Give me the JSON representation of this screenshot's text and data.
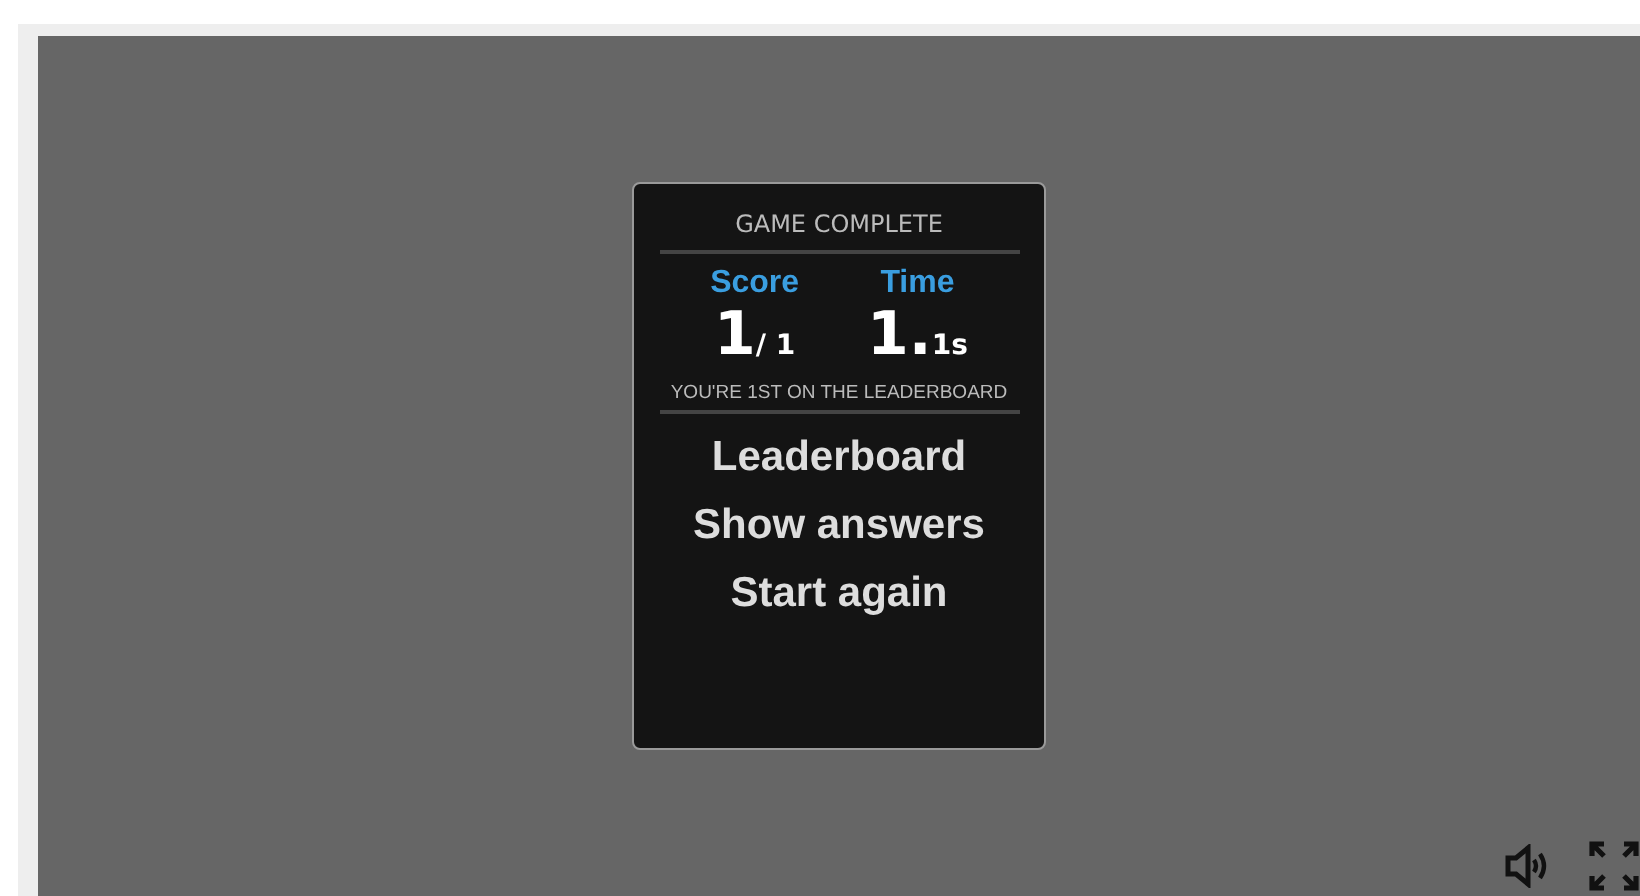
{
  "panel": {
    "title": "GAME COMPLETE",
    "stats": [
      {
        "label": "Score",
        "big": "1",
        "small": "/ 1"
      },
      {
        "label": "Time",
        "big": "1.",
        "small": "1s"
      }
    ],
    "message": "YOU'RE 1ST ON THE LEADERBOARD",
    "buttons": [
      "Leaderboard",
      "Show answers",
      "Start again"
    ]
  },
  "controls": [
    {
      "kind": "sound"
    },
    {
      "kind": "fullscreen"
    }
  ]
}
